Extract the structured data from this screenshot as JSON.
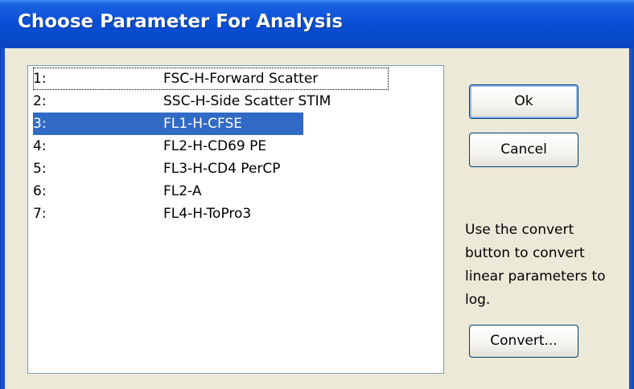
{
  "window": {
    "title": "Choose Parameter For Analysis"
  },
  "parameters": [
    {
      "num": "1:",
      "name": "FSC-H-Forward Scatter"
    },
    {
      "num": "2:",
      "name": "SSC-H-Side Scatter STIM"
    },
    {
      "num": "3:",
      "name": "FL1-H-CFSE"
    },
    {
      "num": "4:",
      "name": "FL2-H-CD69 PE"
    },
    {
      "num": "5:",
      "name": "FL3-H-CD4 PerCP"
    },
    {
      "num": "6:",
      "name": "FL2-A"
    },
    {
      "num": "7:",
      "name": "FL4-H-ToPro3"
    }
  ],
  "selected_index": 2,
  "buttons": {
    "ok": "Ok",
    "cancel": "Cancel",
    "convert": "Convert..."
  },
  "help_text": "Use the convert button to convert linear parameters to log.",
  "colors": {
    "titlebar": "#0a4fd6",
    "selection": "#316ac5",
    "dialog_bg": "#ece9d8"
  }
}
